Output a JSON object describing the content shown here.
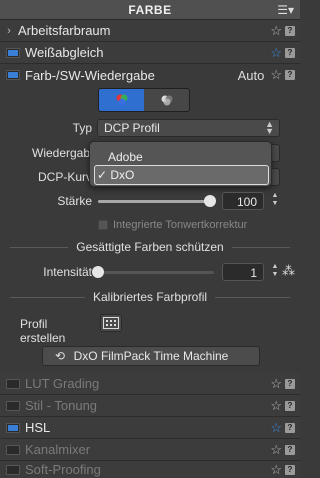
{
  "header": {
    "title": "FARBE",
    "menu_icon": "menu-icon"
  },
  "rows_top": [
    {
      "label": "Arbeitsfarbraum",
      "star": "☆",
      "help": "?"
    },
    {
      "label": "Weißabgleich",
      "star": "☆",
      "help": "?"
    },
    {
      "label": "Farb-/SW-Wiedergabe",
      "extra": "Auto",
      "star": "☆",
      "help": "?"
    }
  ],
  "rendering": {
    "type_label": "Typ",
    "type_value": "DCP Profil",
    "repro_label": "Wiedergabe",
    "curve_label": "DCP-Kurve",
    "dropdown_options": [
      "Adobe",
      "✓ DxO"
    ],
    "strength_label": "Stärke",
    "strength_value": "100",
    "strength_fraction": 1.0,
    "tone_check_label": "Integrierte Tonwertkorrektur"
  },
  "saturation": {
    "section_title": "Gesättigte Farben schützen",
    "intensity_label": "Intensität",
    "intensity_value": "1",
    "intensity_fraction": 0.0
  },
  "profile": {
    "section_title": "Kalibriertes Farbprofil",
    "create_label": "Profil erstellen",
    "filmpack_label": "DxO FilmPack Time Machine"
  },
  "rows_bottom": [
    {
      "label": "LUT Grading",
      "star": "☆",
      "help": "?"
    },
    {
      "label": "Stil - Tonung",
      "star": "☆",
      "help": "?"
    },
    {
      "label": "HSL",
      "star": "☆",
      "help": "?"
    },
    {
      "label": "Kanalmixer",
      "star": "☆",
      "help": "?"
    },
    {
      "label": "Soft-Proofing",
      "star": "☆",
      "help": "?"
    }
  ],
  "colors": {
    "accent": "#3a8ee6",
    "active_segment": "#2f6fd0"
  }
}
